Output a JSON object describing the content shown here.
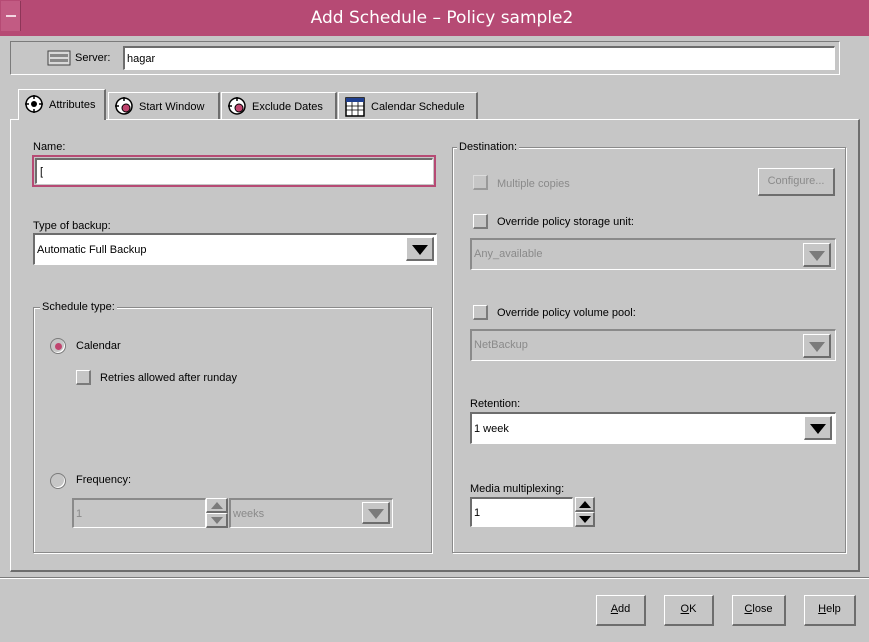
{
  "window": {
    "title": "Add Schedule – Policy sample2"
  },
  "server": {
    "label": "Server:",
    "value": "hagar"
  },
  "tabs": [
    {
      "label": "Attributes",
      "icon": "gear-people-icon",
      "active": true
    },
    {
      "label": "Start Window",
      "icon": "clock-gear-icon",
      "active": false
    },
    {
      "label": "Exclude Dates",
      "icon": "exclude-gear-icon",
      "active": false
    },
    {
      "label": "Calendar Schedule",
      "icon": "calendar-icon",
      "active": false
    }
  ],
  "attributes": {
    "name_label": "Name:",
    "name_value": "[",
    "type_label": "Type of backup:",
    "type_value": "Automatic Full Backup",
    "schedule_type": {
      "legend": "Schedule type:",
      "calendar_label": "Calendar",
      "calendar_selected": true,
      "retries_label": "Retries allowed after runday",
      "frequency_label": "Frequency:",
      "frequency_value": "1",
      "frequency_unit": "weeks"
    }
  },
  "destination": {
    "legend": "Destination:",
    "multiple_copies_label": "Multiple copies",
    "configure_label": "Configure...",
    "override_storage_label": "Override policy storage unit:",
    "storage_value": "Any_available",
    "override_pool_label": "Override policy volume pool:",
    "pool_value": "NetBackup",
    "retention_label": "Retention:",
    "retention_value": "1 week",
    "multiplexing_label": "Media multiplexing:",
    "multiplexing_value": "1"
  },
  "buttons": {
    "add": {
      "label": "Add",
      "mnemonic": "A",
      "rest": "dd"
    },
    "ok": {
      "label": "OK",
      "mnemonic": "O",
      "rest": "K"
    },
    "close": {
      "label": "Close",
      "mnemonic": "C",
      "rest": "lose"
    },
    "help": {
      "label": "Help",
      "mnemonic": "H",
      "rest": "elp"
    }
  },
  "colors": {
    "titlebar": "#b64a74",
    "window_bg": "#c6c6c6",
    "radio_selected": "#c0456f"
  }
}
